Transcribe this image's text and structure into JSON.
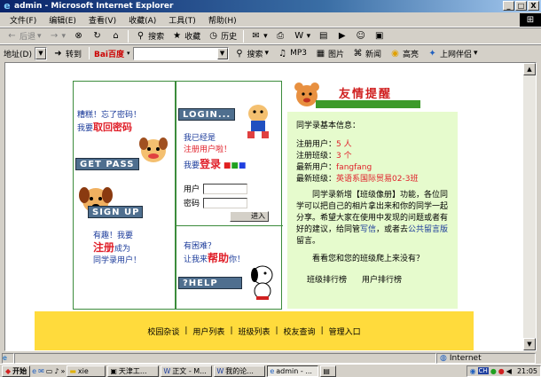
{
  "window": {
    "title": "admin - Microsoft Internet Explorer",
    "buttons": {
      "minimize": "_",
      "maximize": "□",
      "close": "X"
    }
  },
  "menu": [
    "文件(F)",
    "编辑(E)",
    "查看(V)",
    "收藏(A)",
    "工具(T)",
    "帮助(H)"
  ],
  "toolbar": {
    "back": "后退",
    "search": "搜索",
    "favorites": "收藏",
    "history": "历史"
  },
  "addressbar": {
    "label": "地址(D)",
    "goto": "转到",
    "baidu": "Bai百度",
    "search": "搜索",
    "mp3": "MP3",
    "images": "图片",
    "news": "新闻",
    "highlight": "高亮",
    "partner": "上网伴侣"
  },
  "login": {
    "forgot_line1": "糟糕！忘了密码！",
    "forgot_line2_pre": "我要",
    "forgot_line2_link": "取回密码",
    "get_pass_banner": "GET PASS",
    "sign_up_banner": "SIGN UP",
    "signup_line1": "有趣！我要",
    "signup_link": "注册",
    "signup_line2_post": "成为",
    "signup_line3": "同学录用户！",
    "login_banner": "LOGIN...",
    "registered_line1": "我已经是",
    "registered_line2": "注册用户啦！",
    "login_pre": "我要",
    "login_link": "登录",
    "user_label": "用户",
    "password_label": "密码",
    "enter_button": "进入",
    "help_line1": "有困难？",
    "help_pre": "让我来",
    "help_link": "帮助",
    "help_post": "你！",
    "help_banner": "?HELP"
  },
  "info": {
    "header_title": "友情提醒",
    "section_title": "同学录基本信息：",
    "registered_users_label": "注册用户：",
    "registered_users_value": "5 人",
    "registered_classes_label": "注册班级：",
    "registered_classes_value": "3 个",
    "latest_user_label": "最新用户：",
    "latest_user_value": "fangfang",
    "latest_class_label": "最新班级：",
    "latest_class_value": "英语系国际贸易02-3班",
    "notice_pre": "同学录新增【班级像册】功能，各位同学可以把自己的相片拿出来和你的同学一起分享。希望大家在使用中发现的问题或者有好的建议，给同管",
    "notice_link1": "写信",
    "notice_mid": "，或者去",
    "notice_link2": "公共留言版",
    "notice_post": "留言。",
    "question": "看看您和您的班级爬上来没有？",
    "class_rank": "班级排行榜",
    "user_rank": "用户排行榜"
  },
  "footer": {
    "links": [
      "校园杂谈",
      "用户列表",
      "班级列表",
      "校友查询",
      "管理入口"
    ],
    "separator": "|"
  },
  "statusbar": {
    "zone": "Internet"
  },
  "taskbar": {
    "start": "开始",
    "tasks": [
      "xie",
      "天津工...",
      "正文 - M...",
      "我的论...",
      "admin - ...",
      ""
    ],
    "clock": "21:05"
  },
  "colors": {
    "green_border": "#3c8c3c",
    "info_bg": "#e6fbcd",
    "footer_bg": "#ffdb3c",
    "link_red": "#e0202a",
    "text_blue": "#1a3a9a"
  }
}
